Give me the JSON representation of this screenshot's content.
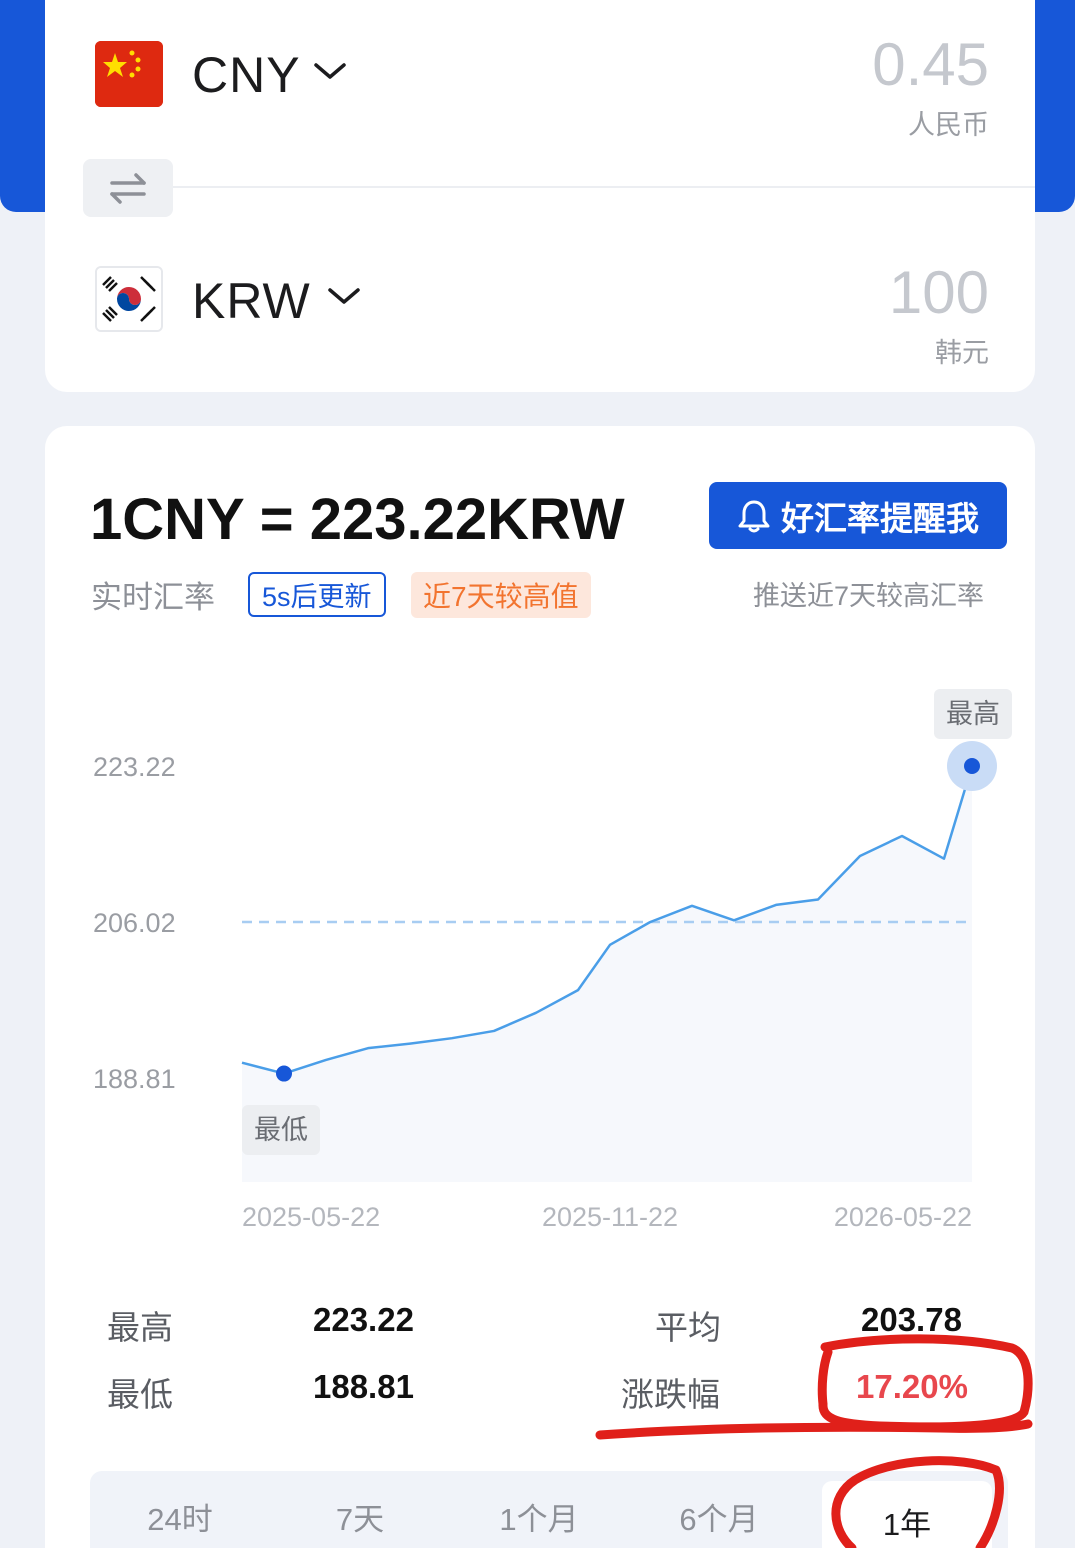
{
  "converter": {
    "from": {
      "code": "CNY",
      "amount": "0.45",
      "unit": "人民币",
      "flag_icon": "china-flag-icon"
    },
    "to": {
      "code": "KRW",
      "amount": "100",
      "unit": "韩元",
      "flag_icon": "south-korea-flag-icon"
    }
  },
  "rate": {
    "headline": "1CNY = 223.22KRW",
    "realtime_label": "实时汇率",
    "update_badge": "5s后更新",
    "high_badge": "近7天较高值",
    "remind_button": "好汇率提醒我",
    "push_text": "推送近7天较高汇率"
  },
  "chart_data": {
    "type": "line",
    "y_ticks": [
      "223.22",
      "206.02",
      "188.81"
    ],
    "x_ticks": [
      "2025-05-22",
      "2025-11-22",
      "2026-05-22"
    ],
    "ylim": [
      188.81,
      223.22
    ],
    "average_line": 206.02,
    "max_label": "最高",
    "min_label": "最低",
    "series": [
      {
        "x": [
          "2025-05-22",
          "2025-06-12",
          "2025-07-03",
          "2025-07-24",
          "2025-08-14",
          "2025-09-04",
          "2025-09-25",
          "2025-10-16",
          "2025-11-06",
          "2025-11-22",
          "2025-12-12",
          "2026-01-02",
          "2026-01-23",
          "2026-02-13",
          "2026-03-06",
          "2026-03-27",
          "2026-04-17",
          "2026-05-08",
          "2026-05-22"
        ],
        "values": [
          190.5,
          189.3,
          190.8,
          192.1,
          192.6,
          193.2,
          194.0,
          196.0,
          198.5,
          203.5,
          206.0,
          207.8,
          206.2,
          207.9,
          208.5,
          213.3,
          215.5,
          213.0,
          223.22
        ]
      }
    ]
  },
  "stats": {
    "high_label": "最高",
    "high_value": "223.22",
    "avg_label": "平均",
    "avg_value": "203.78",
    "low_label": "最低",
    "low_value": "188.81",
    "change_label": "涨跌幅",
    "change_value": "17.20%"
  },
  "tabs": [
    "24时",
    "7天",
    "1个月",
    "6个月",
    "1年"
  ],
  "active_tab": "1年",
  "colors": {
    "brand": "#1757d8",
    "line": "#4a9ee8",
    "down": "#e8474d",
    "annotation": "#e0201a"
  }
}
